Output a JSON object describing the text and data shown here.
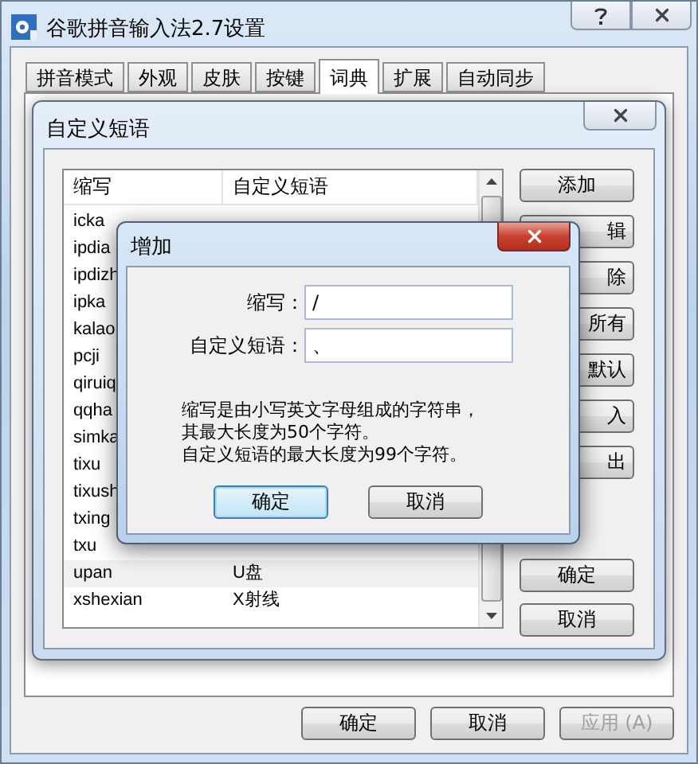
{
  "window": {
    "title": "谷歌拼音输入法2.7设置"
  },
  "tabs": [
    {
      "label": "拼音模式",
      "selected": false
    },
    {
      "label": "外观",
      "selected": false
    },
    {
      "label": "皮肤",
      "selected": false
    },
    {
      "label": "按键",
      "selected": false
    },
    {
      "label": "词典",
      "selected": true
    },
    {
      "label": "扩展",
      "selected": false
    },
    {
      "label": "自动同步",
      "selected": false
    }
  ],
  "phrase_dialog": {
    "title": "自定义短语",
    "columns": [
      "缩写",
      "自定义短语"
    ],
    "rows": [
      {
        "abbr": "icka",
        "selected": false
      },
      {
        "abbr": "ipdia",
        "selected": false
      },
      {
        "abbr": "ipdizh",
        "selected": false
      },
      {
        "abbr": "ipka",
        "selected": false
      },
      {
        "abbr": "kalao",
        "selected": false
      },
      {
        "abbr": "pcji",
        "selected": false
      },
      {
        "abbr": "qiruiq",
        "selected": false
      },
      {
        "abbr": "qqha",
        "selected": false
      },
      {
        "abbr": "simka",
        "selected": false
      },
      {
        "abbr": "tixu",
        "selected": false
      },
      {
        "abbr": "tixush",
        "selected": false
      },
      {
        "abbr": "txing",
        "selected": false
      },
      {
        "abbr": "txu",
        "selected": false
      },
      {
        "abbr": "upan",
        "phrase": "U盘",
        "selected": true
      },
      {
        "abbr": "xshexian",
        "phrase": "X射线",
        "selected": false
      }
    ],
    "side_buttons": [
      {
        "label": "添加",
        "covered": false
      },
      {
        "label": "辑",
        "covered": true
      },
      {
        "label": "除",
        "covered": true
      },
      {
        "label": "所有",
        "covered": true
      },
      {
        "label": "默认",
        "covered": true
      },
      {
        "label": "入",
        "covered": true
      },
      {
        "label": "出",
        "covered": true
      },
      {
        "label": "确定",
        "covered": false
      },
      {
        "label": "取消",
        "covered": false
      }
    ]
  },
  "add_dialog": {
    "title": "增加",
    "fields": [
      {
        "label": "缩写：",
        "value": "/"
      },
      {
        "label": "自定义短语：",
        "value": "、"
      }
    ],
    "note": [
      "缩写是由小写英文字母组成的字符串，",
      "其最大长度为50个字符。",
      "自定义短语的最大长度为99个字符。"
    ],
    "buttons": [
      {
        "label": "确定",
        "default": true
      },
      {
        "label": "取消",
        "default": false
      }
    ]
  },
  "buttons": [
    {
      "label": "确定",
      "disabled": false
    },
    {
      "label": "取消",
      "disabled": false
    },
    {
      "label": "应用 (A)",
      "disabled": true
    }
  ]
}
